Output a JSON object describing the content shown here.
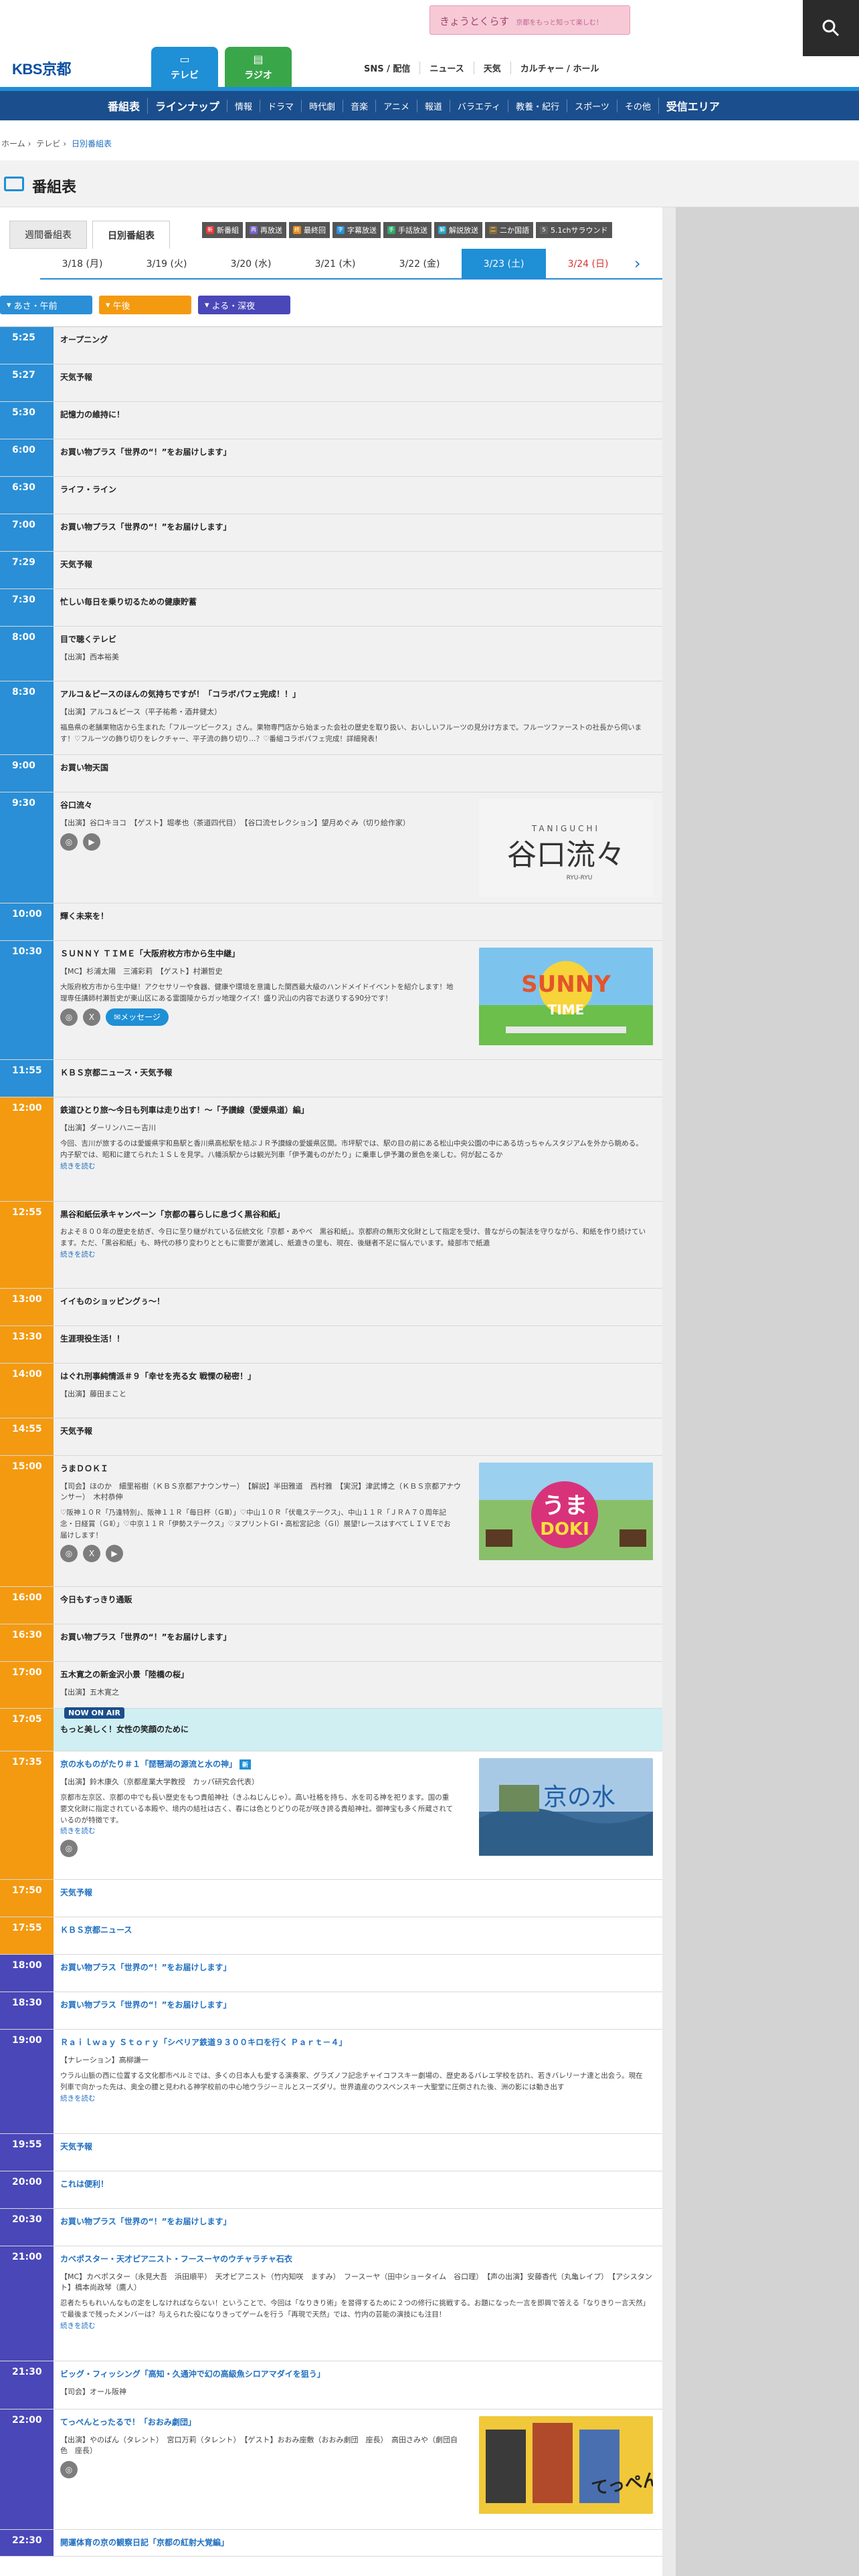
{
  "header": {
    "logo": "KBS京都",
    "banner_text": "きょうとくらす",
    "banner_sub": "京都をもっと知って楽しむ！",
    "tv_tab": "テレビ",
    "radio_tab": "ラジオ",
    "topnav": [
      "SNS / 配信",
      "ニュース",
      "天気",
      "カルチャー / ホール"
    ]
  },
  "bluenav": [
    "番組表",
    "ラインナップ",
    "情報",
    "ドラマ",
    "時代劇",
    "音楽",
    "アニメ",
    "報道",
    "バラエティ",
    "教養・紀行",
    "スポーツ",
    "その他",
    "受信エリア"
  ],
  "breadcrumb": [
    "ホーム",
    "テレビ",
    "日別番組表"
  ],
  "page_title": "番組表",
  "subtabs": [
    "週間番組表",
    "日別番組表"
  ],
  "legend": [
    {
      "mark": "新",
      "label": "新番組",
      "color": "#e03a3a"
    },
    {
      "mark": "再",
      "label": "再放送",
      "color": "#7b61c9"
    },
    {
      "mark": "終",
      "label": "最終回",
      "color": "#e58a1a"
    },
    {
      "mark": "字",
      "label": "字幕放送",
      "color": "#2a8fd6"
    },
    {
      "mark": "手",
      "label": "手話放送",
      "color": "#2ea86a"
    },
    {
      "mark": "解",
      "label": "解説放送",
      "color": "#2aa2c4"
    },
    {
      "mark": "二",
      "label": "二か国語",
      "color": "#8a6b3a"
    },
    {
      "mark": "5",
      "label": "5.1chサラウンド",
      "color": "#666666"
    }
  ],
  "dates": [
    {
      "label": "3/18 (月)",
      "state": "normal"
    },
    {
      "label": "3/19 (火)",
      "state": "normal"
    },
    {
      "label": "3/20 (水)",
      "state": "normal"
    },
    {
      "label": "3/21 (木)",
      "state": "normal"
    },
    {
      "label": "3/22 (金)",
      "state": "normal"
    },
    {
      "label": "3/23 (土)",
      "state": "active"
    },
    {
      "label": "3/24 (日)",
      "state": "sun"
    }
  ],
  "periods": [
    "あさ・午前",
    "午後",
    "よる・深夜"
  ],
  "now_badge": "NOW ON AIR",
  "programs": [
    {
      "time": "5:25",
      "title": "オープニング",
      "band": "am",
      "state": "past",
      "h": 56
    },
    {
      "time": "5:27",
      "title": "天気予報",
      "band": "am",
      "state": "past",
      "h": 56
    },
    {
      "time": "5:30",
      "title": "記憶力の維持に！",
      "band": "am",
      "state": "past",
      "h": 56
    },
    {
      "time": "6:00",
      "title": "お買い物プラス「世界の“！”をお届けします」",
      "band": "am",
      "state": "past",
      "h": 56
    },
    {
      "time": "6:30",
      "title": "ライフ・ライン",
      "band": "am",
      "state": "past",
      "h": 56
    },
    {
      "time": "7:00",
      "title": "お買い物プラス「世界の“！”をお届けします」",
      "band": "am",
      "state": "past",
      "h": 56
    },
    {
      "time": "7:29",
      "title": "天気予報",
      "band": "am",
      "state": "past",
      "h": 56
    },
    {
      "time": "7:30",
      "title": "忙しい毎日を乗り切るための健康貯蓄",
      "band": "am",
      "state": "past",
      "h": 56
    },
    {
      "time": "8:00",
      "title": "目で聴くテレビ",
      "band": "am",
      "state": "past",
      "h": 82,
      "cast": "【出演】西本裕美"
    },
    {
      "time": "8:30",
      "title": "アルコ＆ピースのほんの気持ちですが！「コラボパフェ完成！！」",
      "band": "am",
      "state": "past",
      "h": 110,
      "cast": "【出演】アルコ＆ピース（平子祐希・酒井健太）",
      "desc": "福島県の老舗果物店から生まれた「フルーツピークス」さん。果物専門店から始まった会社の歴史を取り扱い、おいしいフルーツの見分け方まで。フルーツファーストの社長から伺います！♡フルーツの飾り切りをレクチャー、平子流の飾り切り…？♡番組コラボパフェ完成！詳細発表！"
    },
    {
      "time": "9:00",
      "title": "お買い物天国",
      "band": "am",
      "state": "past",
      "h": 56
    },
    {
      "time": "9:30",
      "title": "谷口流々",
      "band": "am",
      "state": "past",
      "h": 166,
      "cast": "【出演】谷口キヨコ　【ゲスト】堀孝也（茶道四代目）　【谷口流セレクション】望月めぐみ（切り絵作家）",
      "thumb": "taniguchi",
      "sns": [
        "instagram",
        "youtube"
      ]
    },
    {
      "time": "10:00",
      "title": "輝く未来を！",
      "band": "am",
      "state": "past",
      "h": 56
    },
    {
      "time": "10:30",
      "title": "ＳＵＮＮＹ ＴＩＭＥ「大阪府枚方市から生中継」",
      "band": "am",
      "state": "past",
      "h": 178,
      "cast": "【MC】杉浦太陽　三浦彩莉　【ゲスト】村瀬哲史",
      "desc": "大阪府枚方市から生中継！アクセサリーや食器、健康や環境を意識した関西最大級のハンドメイドイベントを紹介します！地理専任講師村瀬哲史が東山区にある霊園陵からガッ地理クイズ！盛り沢山の内容でお送りする90分です！",
      "thumb": "sunny",
      "sns": [
        "instagram",
        "x"
      ],
      "msg": "メッセージ"
    },
    {
      "time": "11:55",
      "title": "ＫＢＳ京都ニュース・天気予報",
      "band": "am",
      "state": "past",
      "h": 56
    },
    {
      "time": "12:00",
      "title": "鉄道ひとり旅〜今日も列車は走り出す！〜「予讃線（愛媛県道）編」",
      "band": "pm",
      "state": "past",
      "h": 156,
      "cast": "【出演】ダーリンハニー吉川",
      "desc": "今回、吉川が旅するのは愛媛県宇和島駅と香川県高松駅を結ぶＪＲ予讃線の愛媛県区間。市坪駅では、駅の目の前にある松山中央公園の中にある坊っちゃんスタジアムを外から眺める。内子駅では、昭和に建てられた１ＳＬを見学。八幡浜駅からは観光列車「伊予灘ものがたり」に乗車し伊予灘の景色を楽しむ。何が起こるか",
      "more": "続きを読む"
    },
    {
      "time": "12:55",
      "title": "黒谷和紙伝承キャンペーン「京都の暮らしに息づく黒谷和紙」",
      "band": "pm",
      "state": "past",
      "h": 130,
      "desc": "およそ８００年の歴史を紡ぎ、今日に至り継がれている伝統文化「京都・あやべ　黒谷和紙」。京都府の無形文化財として指定を受け、昔ながらの製法を守りながら、和紙を作り続けています。ただ、「黒谷和紙」も、時代の移り変わりとともに需要が激減し、紙漉きの里も、現在、後継者不足に悩んでいます。綾部市で紙漉",
      "more": "続きを読む"
    },
    {
      "time": "13:00",
      "title": "イイものショッピングぅ〜！",
      "band": "pm",
      "state": "past",
      "h": 56
    },
    {
      "time": "13:30",
      "title": "生涯現役生活！！",
      "band": "pm",
      "state": "past",
      "h": 56
    },
    {
      "time": "14:00",
      "title": "はぐれ刑事純情派＃９「幸せを売る女 戦慄の秘密！」",
      "band": "pm",
      "state": "past",
      "h": 82,
      "cast": "【出演】藤田まこと"
    },
    {
      "time": "14:55",
      "title": "天気予報",
      "band": "pm",
      "state": "past",
      "h": 56
    },
    {
      "time": "15:00",
      "title": "うまＤＯＫＩ",
      "band": "pm",
      "state": "past",
      "h": 196,
      "cast": "【司会】ほのか　細里裕樹（ＫＢＳ京都アナウンサー）　【解説】半田雅道　西村雅　【実況】津武博之（ＫＢＳ京都アナウンサー）　木村恭伸",
      "desc": "♡阪神１０Ｒ「乃逢特別」、阪神１１Ｒ「毎日杯（ＧⅢ）」♡中山１０Ｒ「伏竜ステークス」、中山１１Ｒ「ＪＲＡ７０周年記念・日経賞（ＧⅡ）」♡中京１１Ｒ「伊勢ステークス」♡ヌプリントＧⅠ・高松宮記念（ＧⅠ）展望!レースはすべてＬＩＶＥでお届けします！",
      "thumb": "umadoki",
      "sns": [
        "instagram",
        "x",
        "youtube"
      ]
    },
    {
      "time": "16:00",
      "title": "今日もすっきり通販",
      "band": "pm",
      "state": "past",
      "h": 56
    },
    {
      "time": "16:30",
      "title": "お買い物プラス「世界の“！”をお届けします」",
      "band": "pm",
      "state": "past",
      "h": 56
    },
    {
      "time": "17:00",
      "title": "五木寛之の新金沢小景「陸橋の桜」",
      "band": "pm",
      "state": "past",
      "h": 70,
      "cast": "【出演】五木寛之"
    },
    {
      "time": "17:05",
      "title": "もっと美しく！女性の笑顔のために",
      "band": "pm",
      "state": "now",
      "h": 64
    },
    {
      "time": "17:35",
      "title": "京の水ものがたり＃１「琵琶湖の源流と水の神」",
      "band": "pm",
      "state": "future",
      "h": 192,
      "cast": "【出演】鈴木康久（京都産業大学教授　カッパ研究会代表）",
      "desc": "京都市左京区、京都の中でも長い歴史をもつ貴船神社（きふねじんじゃ）。高い社格を持ち、水を司る神を祀ります。国の重要文化財に指定されている本殿や、境内の結社は古く、春には色とりどりの花が咲き誇る貴船神社。御神宝も多く所蔵されているのが特徴です。",
      "more": "続きを読む",
      "thumb": "mizu",
      "sns": [
        "instagram"
      ],
      "newmark": "新"
    },
    {
      "time": "17:50",
      "title": "天気予報",
      "band": "pm",
      "state": "future",
      "h": 56
    },
    {
      "time": "17:55",
      "title": "ＫＢＳ京都ニュース",
      "band": "pm",
      "state": "future",
      "h": 56
    },
    {
      "time": "18:00",
      "title": "お買い物プラス「世界の“！”をお届けします」",
      "band": "ng",
      "state": "future",
      "h": 56
    },
    {
      "time": "18:30",
      "title": "お買い物プラス「世界の“！”をお届けします」",
      "band": "ng",
      "state": "future",
      "h": 56
    },
    {
      "time": "19:00",
      "title": "Ｒａｉｌｗａｙ Ｓｔｏｒｙ「シベリア鉄道９３００キロを行く Ｐａｒｔ－４」",
      "band": "ng",
      "state": "future",
      "h": 156,
      "cast": "【ナレーション】高柳謙一",
      "desc": "ウラル山脈の西に位置する文化都市ペルミでは、多くの日本人も愛する演奏家、グラズノフ記念チャイコフスキー劇場の、歴史あるバレエ学校を訪れ、若きバレリーナ達と出会う。現在列車で向かった先は、奥全の腰と見われる神学校前の中心地ウラジーミルとスーズダリ。世界遺産のウスペンスキー大聖堂に圧倒された後、洲の影には動き出す",
      "more": "続きを読む"
    },
    {
      "time": "19:55",
      "title": "天気予報",
      "band": "ng",
      "state": "future",
      "h": 56
    },
    {
      "time": "20:00",
      "title": "これは便利！",
      "band": "ng",
      "state": "future",
      "h": 56
    },
    {
      "time": "20:30",
      "title": "お買い物プラス「世界の“！”をお届けします」",
      "band": "ng",
      "state": "future",
      "h": 56
    },
    {
      "time": "21:00",
      "title": "カベポスター・天才ピアニスト・フースーヤのウチャラチャ石衣",
      "band": "ng",
      "state": "future",
      "h": 172,
      "cast": "【MC】カベポスター（永見大吾　浜田順平）　天才ピアニスト（竹内知咲　ますみ）　フースーヤ（田中ショータイム　谷口理）　【声の出演】安藤香代（丸亀レイプ）　【アシスタント】橋本尚政琴（鷹人）",
      "desc": "忍者たちもれいんなもの定をしなければならない！ということで、今回は「なりきり術」を習得するために２つの修行に挑戦する。お題になった一言を即興で答える「なりきりー言天然」で最後まで残ったメンバーは？与えられた役になりきってゲームを行う「再現で天然」では、竹内の芸能の演技にも注目！",
      "more": "続きを読む"
    },
    {
      "time": "21:30",
      "title": "ビッグ・フィッシング「高知・久通沖で幻の高級魚シロアマダイを狙う」",
      "band": "ng",
      "state": "future",
      "h": 72,
      "cast": "【司会】オール阪神"
    },
    {
      "time": "22:00",
      "title": "てっぺんとったるで！「おおみ劇団」",
      "band": "ng",
      "state": "future",
      "h": 180,
      "cast": "【出演】やのぱん（タレント）　宮口万莉（タレント）　【ゲスト】おおみ座敷（おおみ劇団　座長）　高田さみや（劇団自色　座長）",
      "thumb": "teppen",
      "sns": [
        "instagram"
      ]
    },
    {
      "time": "22:30",
      "title": "開運体育の京の観察日記「京都の紅射大覚編」",
      "band": "ng",
      "state": "future",
      "h": 40
    }
  ]
}
